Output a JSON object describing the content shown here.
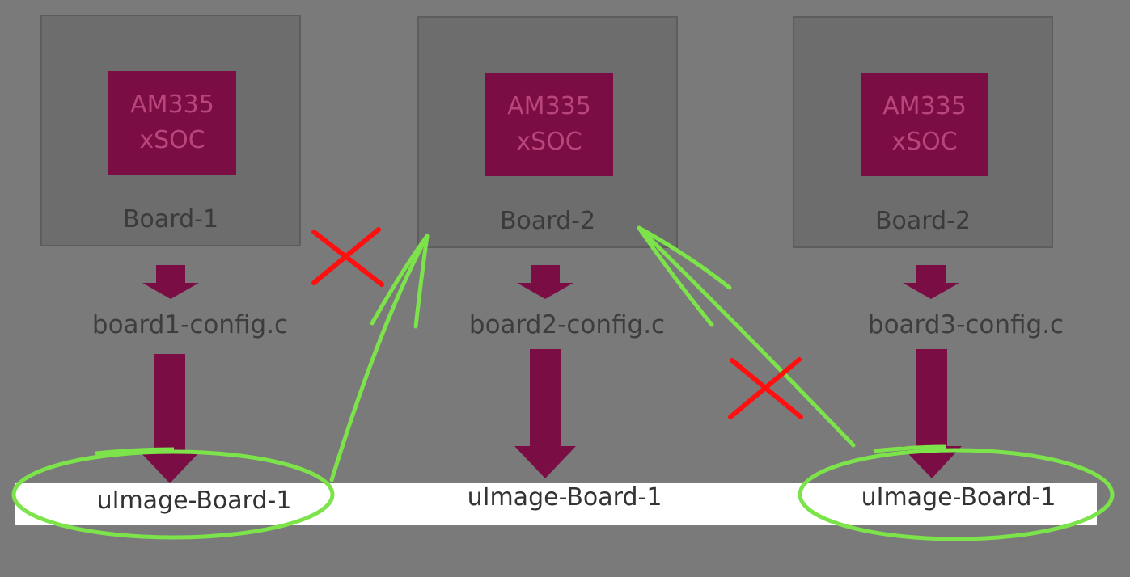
{
  "boards": [
    {
      "chip_line1": "AM335",
      "chip_line2": "xSOC",
      "label": "Board-1",
      "config": "board1-config.c",
      "image": "uImage-Board-1"
    },
    {
      "chip_line1": "AM335",
      "chip_line2": "xSOC",
      "label": "Board-2",
      "config": "board2-config.c",
      "image": "uImage-Board-1"
    },
    {
      "chip_line1": "AM335",
      "chip_line2": "xSOC",
      "label": "Board-2",
      "config": "board3-config.c",
      "image": "uImage-Board-1"
    }
  ],
  "colors": {
    "chip": "#7a0d44",
    "arrow": "#7a0d44",
    "annotation_green": "#7ce34a",
    "annotation_red": "#ff1010"
  }
}
